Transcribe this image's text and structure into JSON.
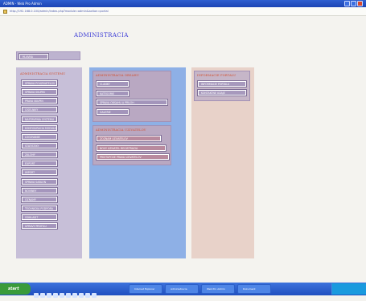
{
  "window": {
    "title": "ADMIN - Web Pro Admin",
    "address": "http://192.168.0.100/admin/index.php?module=admin&action=portal"
  },
  "page": {
    "heading": "ADMINISTRACIA",
    "top_button": "HLAVNA"
  },
  "column1": {
    "title": "ADMINISTRACIA SYSTEMU",
    "items": [
      "SPRAVA POUZIVATELOV",
      "SPRAVA SKUPIN",
      "PRAVA SKUPIN",
      "CISELNIKY",
      "NASTAVENIA SYSTEMU",
      "KONFIGURACIA MODULOV",
      "LOGOVANIE",
      "STATISTIKY",
      "ZALOHY",
      "EXPORT",
      "IMPORT",
      "SPRAVA SABLON",
      "NOVINKY",
      "OZNAMY",
      "TECHNICKA PODPORA",
      "ODHLASIT",
      "UPRAVY PROFILU"
    ]
  },
  "column2": {
    "section_a": {
      "title": "ADMINISTRACIA OBSAHU",
      "items": [
        "CLANKY",
        "KATEGORIE",
        "SPRAVA OBSAHU A PRILOH",
        "GALERIE"
      ]
    },
    "section_b": {
      "title": "ADMINISTRACIA UZIVATELOV",
      "items": [
        "ZOZNAM UZIVATELOV",
        "NOVY UZIVATEL REGISTRACIA",
        "PRISTUPOVE PRAVA UZIVATELOV"
      ]
    }
  },
  "column3": {
    "title": "INFORMACIE PORTALU",
    "items": [
      "INFORMACIE PORTALU",
      "KONTAKTNE UDAJE"
    ]
  },
  "taskbar": {
    "start": "start",
    "tasks": [
      "Internet Explorer",
      "Administracia",
      "Web Pro Admin",
      "Dokument"
    ]
  }
}
